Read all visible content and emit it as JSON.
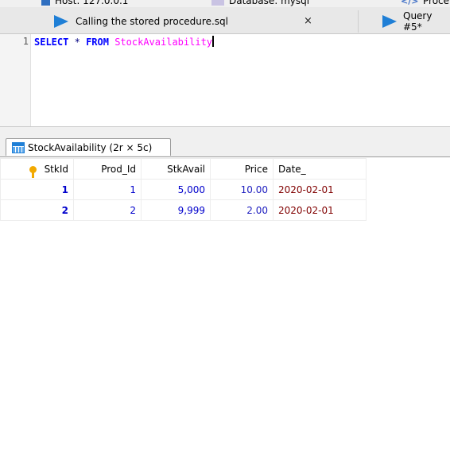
{
  "top_tabs": [
    {
      "label": "Host: 127.0.0.1",
      "icon": "server-icon"
    },
    {
      "label": "Database: mysql",
      "icon": "database-icon"
    },
    {
      "label": "Proce",
      "icon": "procedure-icon"
    }
  ],
  "file_tabs": {
    "active_label": "Calling the stored procedure.sql",
    "close_glyph": "×",
    "other_label": "Query #5*"
  },
  "editor": {
    "line_number": "1",
    "keyword_select": "SELECT",
    "operator": "*",
    "keyword_from": "FROM",
    "table_name": "StockAvailability"
  },
  "result_tab": {
    "label": "StockAvailability (2r × 5c)"
  },
  "grid": {
    "columns": [
      "StkId",
      "Prod_Id",
      "StkAvail",
      "Price",
      "Date_"
    ],
    "rows": [
      [
        "1",
        "1",
        "5,000",
        "10.00",
        "2020-02-01"
      ],
      [
        "2",
        "2",
        "9,999",
        "2.00",
        "2020-02-01"
      ]
    ]
  },
  "colors": {
    "keyword": "#0000ff",
    "table_name": "#ff00ff",
    "date_value": "#800000",
    "number_value": "#0000cc"
  }
}
